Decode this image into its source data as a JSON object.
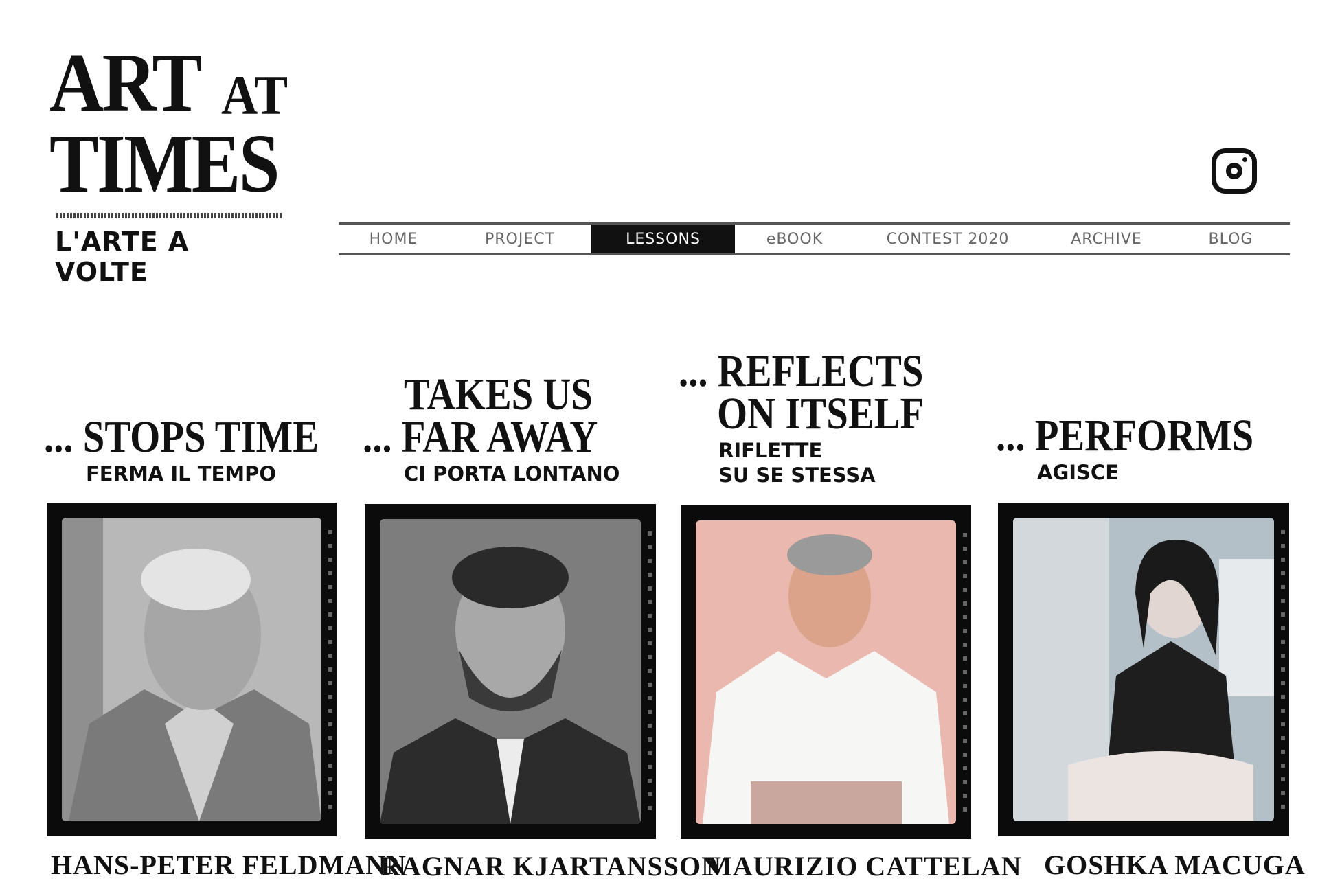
{
  "logo": {
    "line1": "ART",
    "line1_small": "AT",
    "line2": "TIMES",
    "subtitle": "L'ARTE A VOLTE"
  },
  "social": {
    "icon": "instagram-icon"
  },
  "nav": {
    "items": [
      "HOME",
      "PROJECT",
      "LESSONS",
      "eBOOK",
      "CONTEST 2020",
      "ARCHIVE",
      "BLOG"
    ],
    "active": "LESSONS"
  },
  "cards": [
    {
      "heading_lines": [
        "... STOPS TIME"
      ],
      "subtitle_lines": [
        "FERMA IL TEMPO"
      ],
      "name": "Hans-Peter Feldmann",
      "name_display": "HANS-PETER FELDMANN",
      "photo_tone": "#9c9c9c"
    },
    {
      "heading_lines": [
        "TAKES US",
        "... FAR AWAY"
      ],
      "subtitle_lines": [
        "CI PORTA LONTANO"
      ],
      "name": "Ragnar Kjartansson",
      "name_display": "RAGNAR KJARTANSSON",
      "photo_tone": "#6c6c6c"
    },
    {
      "heading_lines": [
        "... REFLECTS",
        "ON ITSELF"
      ],
      "subtitle_lines": [
        "RIFLETTE",
        "SU SE STESSA"
      ],
      "name": "Maurizio Cattelan",
      "name_display": "MAURIZIO CATTELAN",
      "photo_tone": "#e8b8ae"
    },
    {
      "heading_lines": [
        "... PERFORMS"
      ],
      "subtitle_lines": [
        "AGISCE"
      ],
      "name": "Goshka Macuga",
      "name_display": "GOSHKA MACUGA",
      "photo_tone": "#a8b4bc"
    }
  ]
}
